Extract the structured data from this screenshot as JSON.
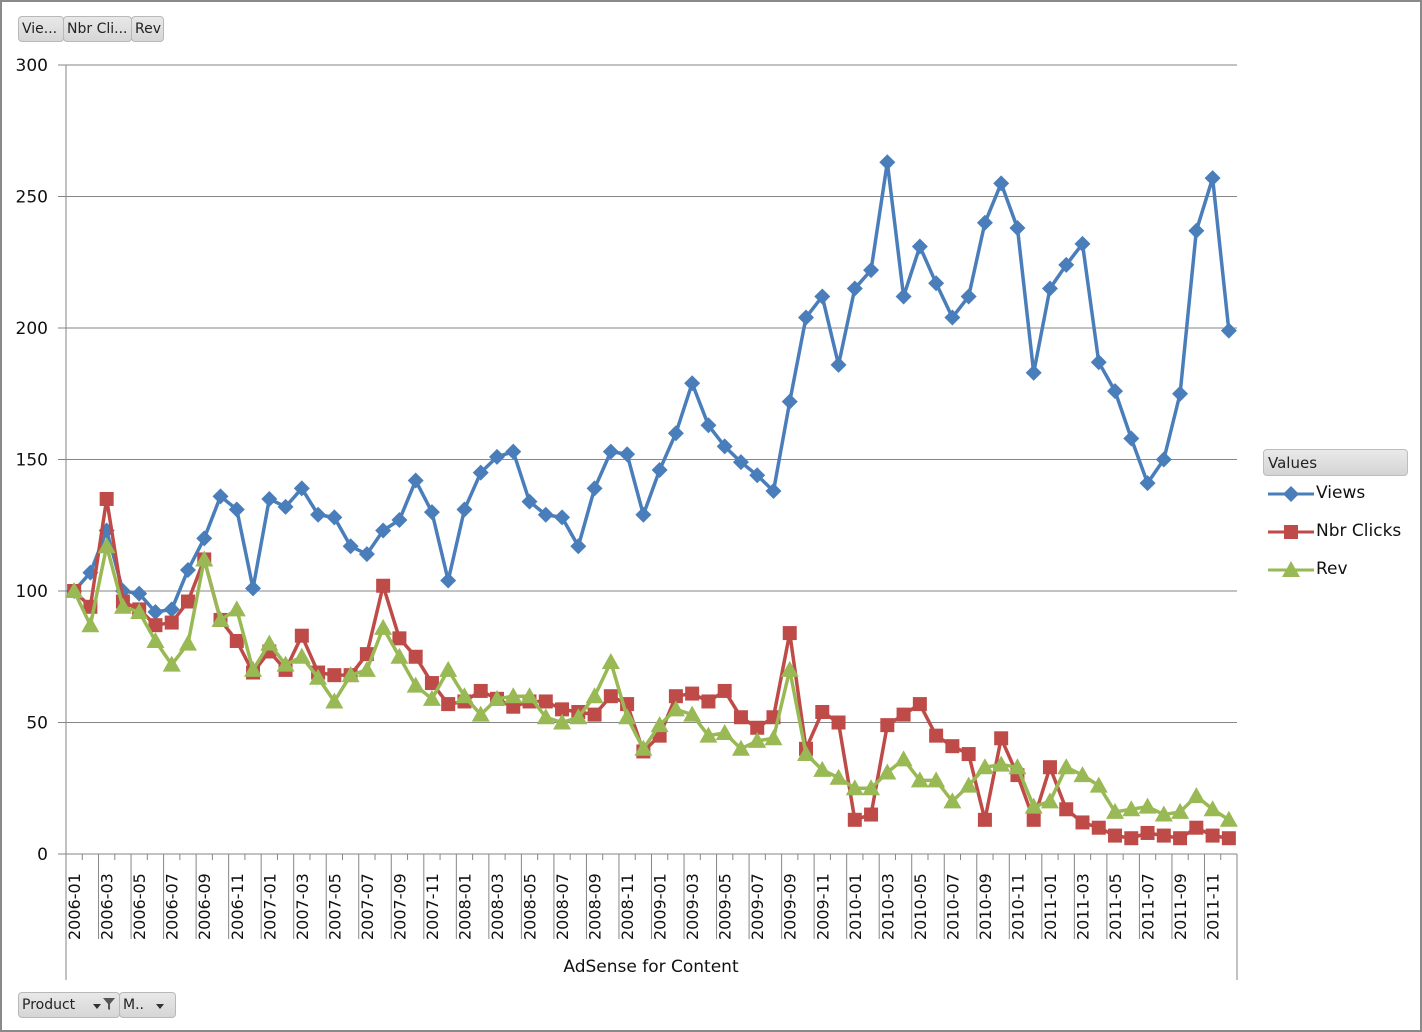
{
  "field_buttons": {
    "views_label": "Vie...",
    "clicks_label": "Nbr Cli...",
    "rev_label": "Rev",
    "product_label": "Product",
    "month_label": "M.."
  },
  "legend": {
    "header": "Values",
    "items": [
      {
        "name": "Views",
        "color": "#4a7ebb",
        "marker": "diamond"
      },
      {
        "name": "Nbr Clicks",
        "color": "#be4b48",
        "marker": "square"
      },
      {
        "name": "Rev",
        "color": "#98b954",
        "marker": "triangle"
      }
    ]
  },
  "chart_data": {
    "type": "line",
    "title": "",
    "xlabel": "AdSense for Content",
    "ylabel": "",
    "ylim": [
      0,
      300
    ],
    "yticks": [
      0,
      50,
      100,
      150,
      200,
      250,
      300
    ],
    "grid": true,
    "legend_position": "right",
    "categories": [
      "2006-01",
      "2006-02",
      "2006-03",
      "2006-04",
      "2006-05",
      "2006-06",
      "2006-07",
      "2006-08",
      "2006-09",
      "2006-10",
      "2006-11",
      "2006-12",
      "2007-01",
      "2007-02",
      "2007-03",
      "2007-04",
      "2007-05",
      "2007-06",
      "2007-07",
      "2007-08",
      "2007-09",
      "2007-10",
      "2007-11",
      "2007-12",
      "2008-01",
      "2008-02",
      "2008-03",
      "2008-04",
      "2008-05",
      "2008-06",
      "2008-07",
      "2008-08",
      "2008-09",
      "2008-10",
      "2008-11",
      "2008-12",
      "2009-01",
      "2009-02",
      "2009-03",
      "2009-04",
      "2009-05",
      "2009-06",
      "2009-07",
      "2009-08",
      "2009-09",
      "2009-10",
      "2009-11",
      "2009-12",
      "2010-01",
      "2010-02",
      "2010-03",
      "2010-04",
      "2010-05",
      "2010-06",
      "2010-07",
      "2010-08",
      "2010-09",
      "2010-10",
      "2010-11",
      "2010-12",
      "2011-01",
      "2011-02",
      "2011-03",
      "2011-04",
      "2011-05",
      "2011-06",
      "2011-07",
      "2011-08",
      "2011-09",
      "2011-10",
      "2011-11",
      "2011-12"
    ],
    "tick_labels_shown": "every other category (odd months)",
    "series": [
      {
        "name": "Views",
        "color": "#4a7ebb",
        "marker": "diamond",
        "values": [
          100,
          107,
          123,
          100,
          99,
          92,
          93,
          108,
          120,
          136,
          131,
          101,
          135,
          132,
          139,
          129,
          128,
          117,
          114,
          123,
          127,
          142,
          130,
          104,
          131,
          145,
          151,
          153,
          134,
          129,
          128,
          117,
          139,
          153,
          152,
          129,
          146,
          160,
          179,
          163,
          155,
          149,
          144,
          138,
          172,
          204,
          212,
          186,
          215,
          222,
          263,
          212,
          231,
          217,
          204,
          212,
          240,
          255,
          238,
          183,
          215,
          224,
          232,
          187,
          176,
          158,
          141,
          150,
          175,
          237,
          257,
          199
        ]
      },
      {
        "name": "Nbr Clicks",
        "color": "#be4b48",
        "marker": "square",
        "values": [
          100,
          94,
          135,
          96,
          93,
          87,
          88,
          96,
          112,
          89,
          81,
          69,
          77,
          70,
          83,
          69,
          68,
          68,
          76,
          102,
          82,
          75,
          65,
          57,
          58,
          62,
          59,
          56,
          58,
          58,
          55,
          54,
          53,
          60,
          57,
          39,
          45,
          60,
          61,
          58,
          62,
          52,
          48,
          52,
          84,
          40,
          54,
          50,
          13,
          15,
          49,
          53,
          57,
          45,
          41,
          38,
          13,
          44,
          30,
          13,
          33,
          17,
          12,
          10,
          7,
          6,
          8,
          7,
          6,
          10,
          7,
          6
        ]
      },
      {
        "name": "Rev",
        "color": "#98b954",
        "marker": "triangle",
        "values": [
          100,
          87,
          117,
          94,
          92,
          81,
          72,
          80,
          112,
          89,
          93,
          70,
          80,
          72,
          75,
          67,
          58,
          68,
          70,
          86,
          75,
          64,
          59,
          70,
          60,
          53,
          59,
          60,
          60,
          52,
          50,
          52,
          60,
          73,
          52,
          40,
          49,
          55,
          53,
          45,
          46,
          40,
          43,
          44,
          70,
          38,
          32,
          29,
          25,
          25,
          31,
          36,
          28,
          28,
          20,
          26,
          33,
          34,
          33,
          18,
          20,
          33,
          30,
          26,
          16,
          17,
          18,
          15,
          16,
          22,
          17,
          13
        ]
      }
    ]
  }
}
